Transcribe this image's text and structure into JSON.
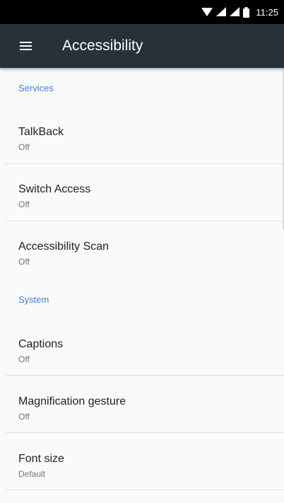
{
  "status_bar": {
    "time": "11:25",
    "icons": [
      "wifi-icon",
      "signal-icon",
      "signal-icon",
      "battery-icon"
    ]
  },
  "toolbar": {
    "title": "Accessibility",
    "menu_icon": "menu-icon"
  },
  "sections": [
    {
      "header": "Services",
      "items": [
        {
          "title": "TalkBack",
          "summary": "Off"
        },
        {
          "title": "Switch Access",
          "summary": "Off"
        },
        {
          "title": "Accessibility Scan",
          "summary": "Off"
        }
      ]
    },
    {
      "header": "System",
      "items": [
        {
          "title": "Captions",
          "summary": "Off"
        },
        {
          "title": "Magnification gesture",
          "summary": "Off"
        },
        {
          "title": "Font size",
          "summary": "Default"
        }
      ]
    }
  ],
  "colors": {
    "status_bar": "#000000",
    "toolbar": "#263238",
    "accent": "#3f7fe0",
    "background": "#fafafa",
    "divider": "#e0e0e0"
  }
}
